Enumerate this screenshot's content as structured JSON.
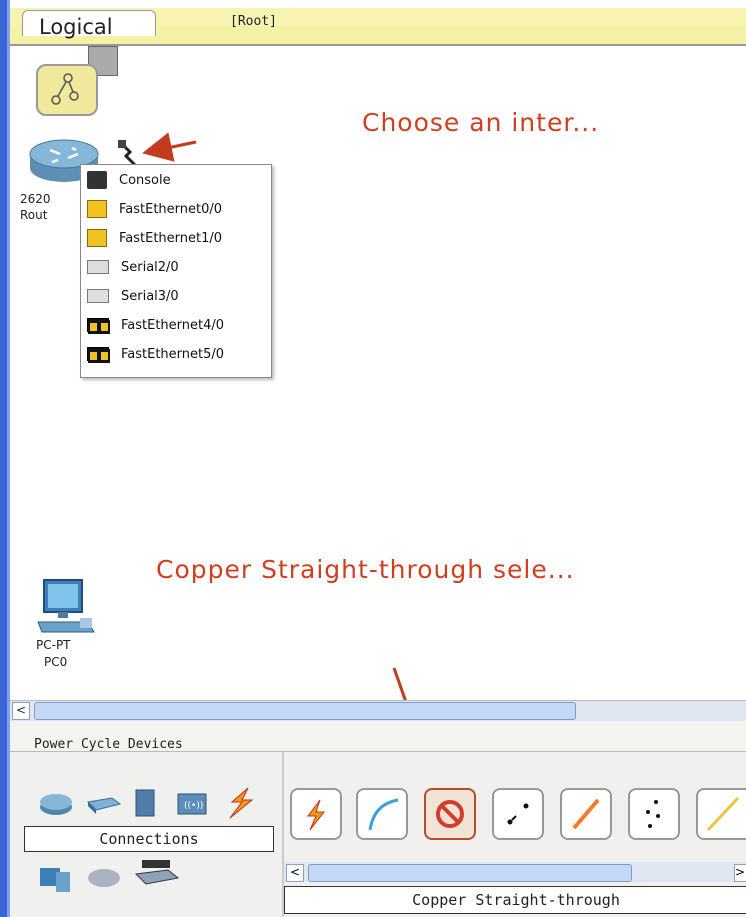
{
  "workspace": {
    "tab_label": "Logical",
    "root_label": "[Root]",
    "annotation_choose": "Choose an inter...",
    "annotation_copper": "Copper Straight-through sele..."
  },
  "router": {
    "label_line1": "2620",
    "label_line2": "Rout"
  },
  "interface_menu": {
    "items": [
      {
        "label": "Console",
        "icon": "console-port-icon"
      },
      {
        "label": "FastEthernet0/0",
        "icon": "fastethernet-port-icon"
      },
      {
        "label": "FastEthernet1/0",
        "icon": "fastethernet-port-icon"
      },
      {
        "label": "Serial2/0",
        "icon": "serial-port-icon"
      },
      {
        "label": "Serial3/0",
        "icon": "serial-port-icon"
      },
      {
        "label": "FastEthernet4/0",
        "icon": "fastethernet-module-icon"
      },
      {
        "label": "FastEthernet5/0",
        "icon": "fastethernet-module-icon"
      }
    ]
  },
  "pc": {
    "label_line1": "PC-PT",
    "label_line2": "PC0"
  },
  "bottom": {
    "power_cycle_label": "Power Cycle Devices",
    "connections_label": "Connections",
    "selected_cable_label": "Copper Straight-through"
  },
  "cable_buttons": [
    {
      "icon": "automatic-cable-icon"
    },
    {
      "icon": "console-cable-icon"
    },
    {
      "icon": "copper-straight-through-icon",
      "selected": true
    },
    {
      "icon": "copper-cross-over-icon"
    },
    {
      "icon": "fiber-cable-icon"
    },
    {
      "icon": "phone-cable-icon"
    },
    {
      "icon": "coaxial-cable-icon"
    }
  ],
  "colors": {
    "annotation_red": "#d04020",
    "frame_blue": "#3b67d6",
    "topbar_yellow": "#f5f1a6"
  }
}
